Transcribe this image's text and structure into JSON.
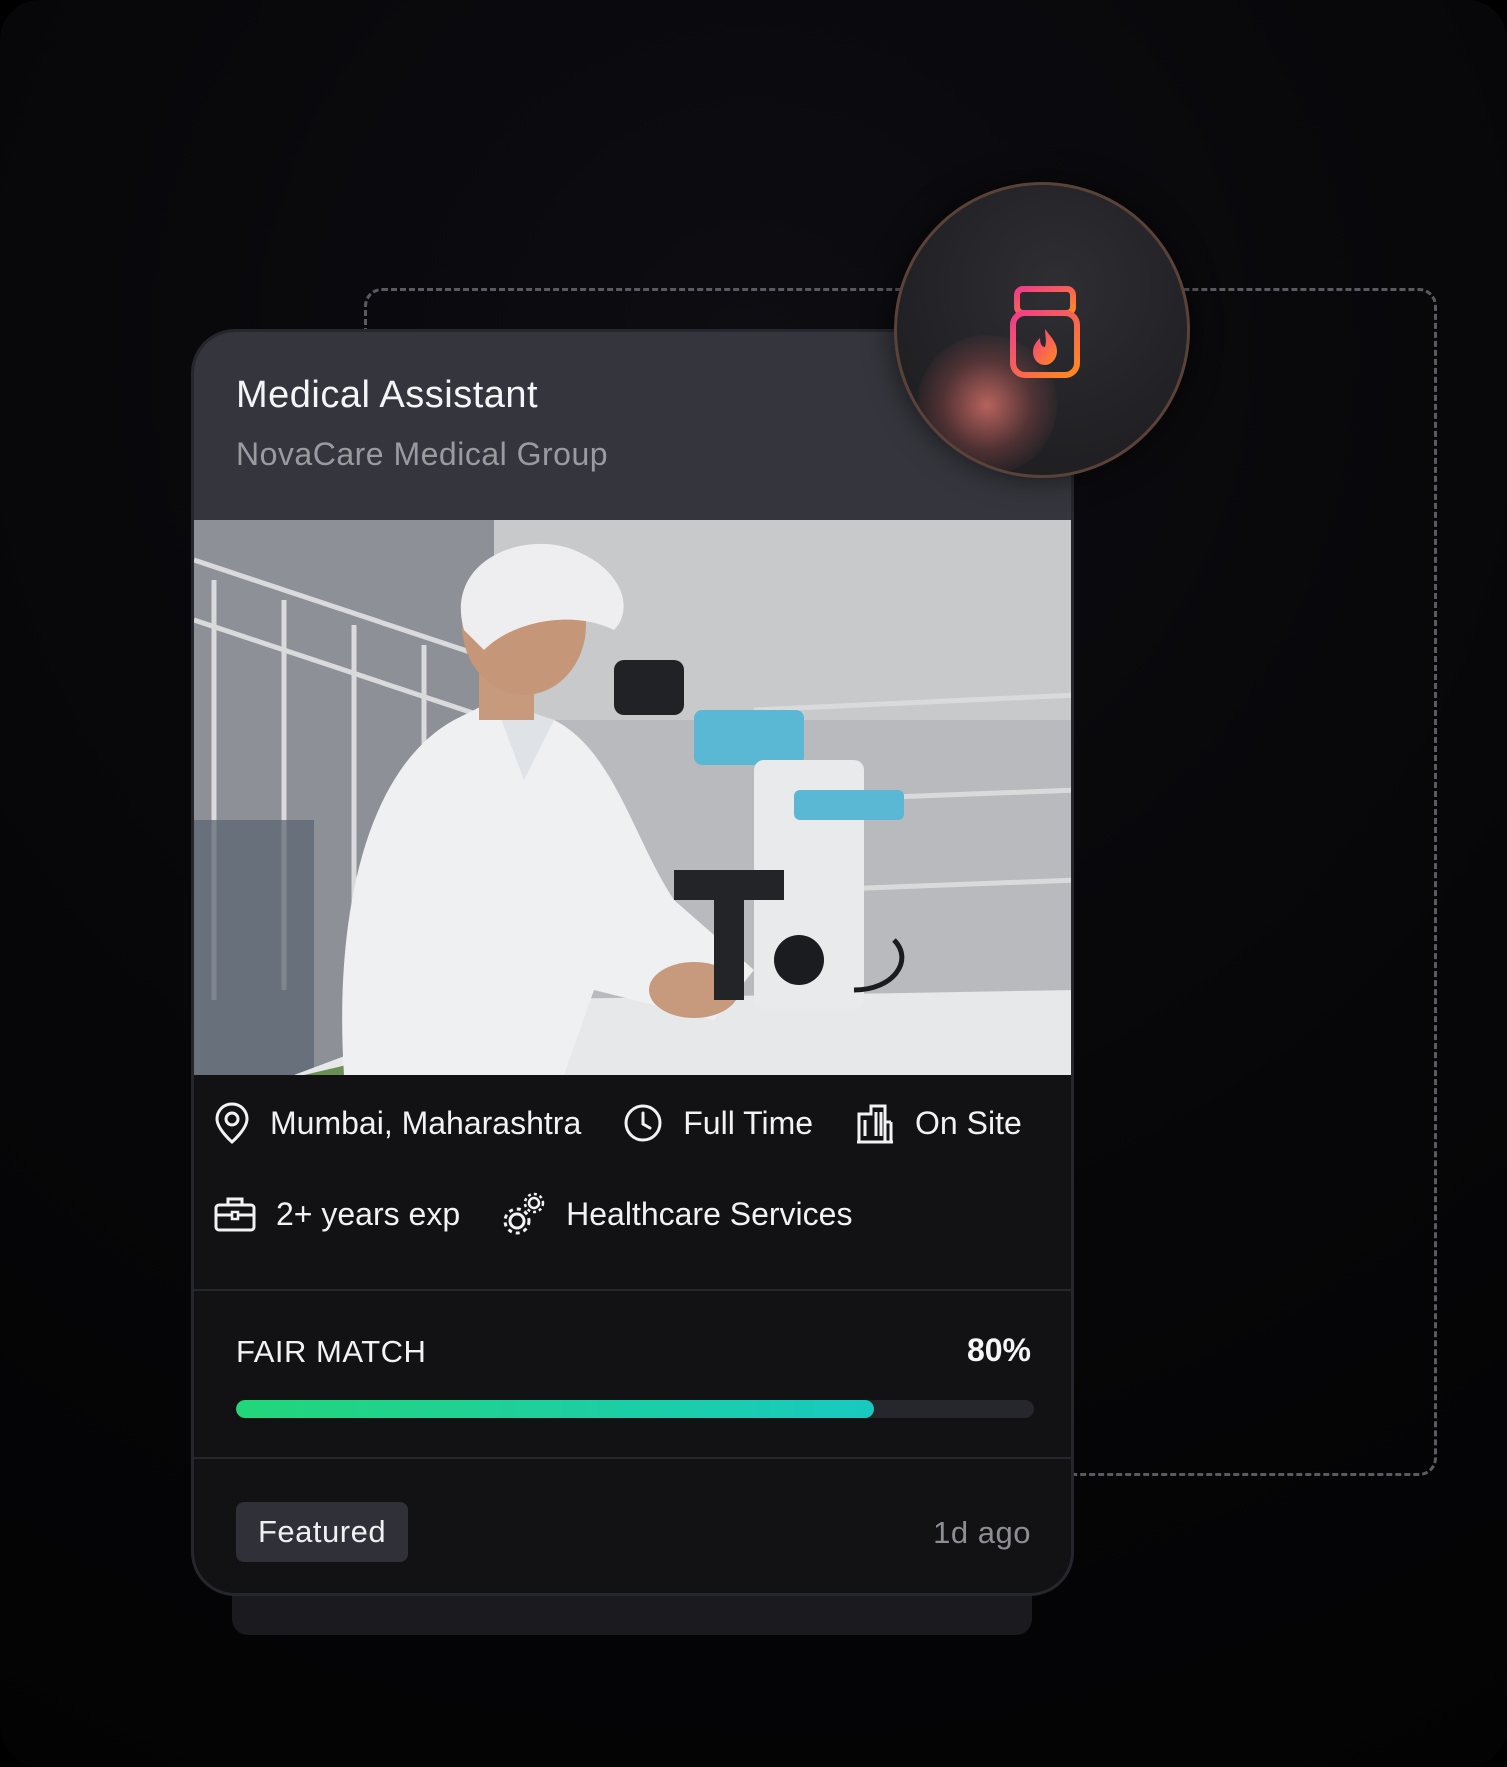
{
  "colors": {
    "card_header": "#35363d",
    "card_body": "#121215",
    "progress_start": "#22d67a",
    "progress_end": "#19c9c0",
    "orb_icon_start": "#f03c8a",
    "orb_icon_end": "#ff8a1e"
  },
  "job": {
    "title": "Medical Assistant",
    "company": "NovaCare Medical Group"
  },
  "meta": {
    "location": "Mumbai, Maharashtra",
    "employment_type": "Full Time",
    "workplace": "On Site",
    "experience": "2+ years exp",
    "industry": "Healthcare Services"
  },
  "icons": {
    "location": "map-pin-icon",
    "employment_type": "clock-icon",
    "workplace": "building-icon",
    "experience": "briefcase-icon",
    "industry": "gears-icon",
    "orb": "fire-jar-icon"
  },
  "match": {
    "label": "FAIR MATCH",
    "percent_text": "80%",
    "percent": 80
  },
  "footer": {
    "badge": "Featured",
    "posted": "1d ago"
  }
}
